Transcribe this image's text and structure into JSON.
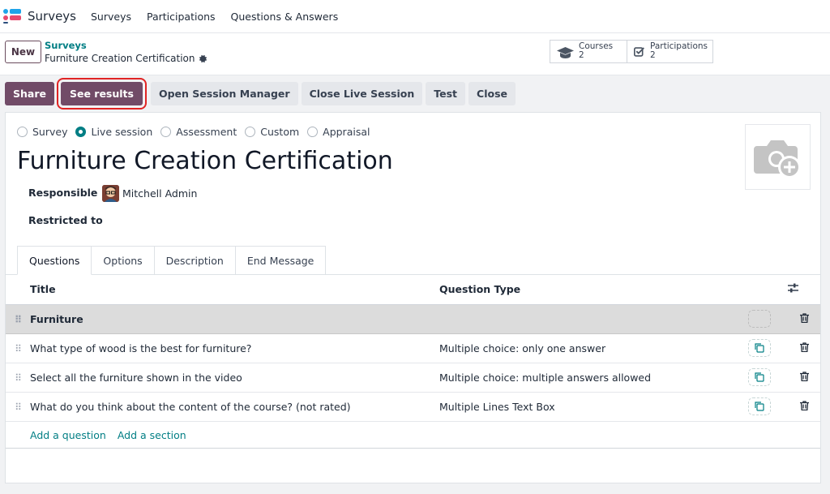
{
  "nav": {
    "app_title": "Surveys",
    "menu": [
      "Surveys",
      "Participations",
      "Questions & Answers"
    ],
    "logo_colors": [
      "#1ea4e9",
      "#e84a6e",
      "#2b4d7c"
    ]
  },
  "control_panel": {
    "new_label": "New",
    "breadcrumb_parent": "Surveys",
    "breadcrumb_current": "Furniture Creation Certification",
    "stats": [
      {
        "label": "Courses",
        "value": "2",
        "icon": "graduation-cap-icon"
      },
      {
        "label": "Participations",
        "value": "2",
        "icon": "checkbox-icon"
      }
    ]
  },
  "statusbar": {
    "share": "Share",
    "see_results": "See results",
    "open_session_manager": "Open Session Manager",
    "close_live_session": "Close Live Session",
    "test": "Test",
    "close": "Close"
  },
  "form": {
    "survey_types": [
      {
        "label": "Survey",
        "checked": false
      },
      {
        "label": "Live session",
        "checked": true
      },
      {
        "label": "Assessment",
        "checked": false
      },
      {
        "label": "Custom",
        "checked": false
      },
      {
        "label": "Appraisal",
        "checked": false
      }
    ],
    "title": "Furniture Creation Certification",
    "responsible_label": "Responsible",
    "responsible_value": "Mitchell Admin",
    "restricted_label": "Restricted to",
    "tabs": [
      "Questions",
      "Options",
      "Description",
      "End Message"
    ],
    "columns": {
      "title": "Title",
      "type": "Question Type"
    },
    "rows": [
      {
        "title": "Furniture",
        "type": "",
        "section": true
      },
      {
        "title": "What type of wood is the best for furniture?",
        "type": "Multiple choice: only one answer",
        "section": false
      },
      {
        "title": "Select all the furniture shown in the video",
        "type": "Multiple choice: multiple answers allowed",
        "section": false
      },
      {
        "title": "What do you think about the content of the course? (not rated)",
        "type": "Multiple Lines Text Box",
        "section": false
      }
    ],
    "add_question": "Add a question",
    "add_section": "Add a section"
  },
  "colors": {
    "primary": "#714b67",
    "link": "#017e84"
  }
}
